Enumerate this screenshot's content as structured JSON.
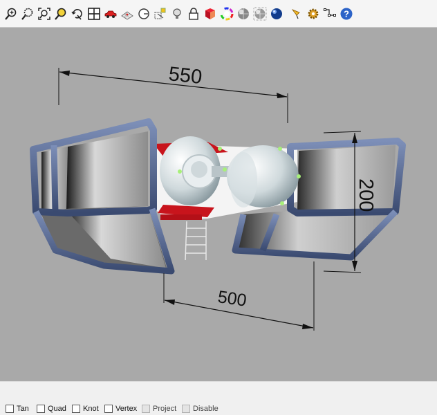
{
  "toolbar": {
    "icons": [
      "zoom-in-icon",
      "zoom-window-icon",
      "zoom-extents-icon",
      "zoom-selected-icon",
      "rotate-view-icon",
      "four-viewports-icon",
      "car-object-icon",
      "grid-plane-icon",
      "clock-icon",
      "select-points-icon",
      "light-bulb-icon",
      "lock-icon",
      "render-material-icon",
      "color-wheel-icon",
      "shaded-sphere-icon",
      "ghosted-sphere-icon",
      "rendered-sphere-icon",
      "pen-tool-icon",
      "gear-settings-icon",
      "polyline-points-icon",
      "help-icon"
    ]
  },
  "viewport": {
    "dimensions": {
      "top_width": "550",
      "right_height": "200",
      "bottom_width": "500"
    }
  },
  "statusbar": {
    "osnaps": [
      {
        "label": "Tan",
        "checked": false,
        "enabled": true
      },
      {
        "label": "Quad",
        "checked": false,
        "enabled": true
      },
      {
        "label": "Knot",
        "checked": false,
        "enabled": true
      },
      {
        "label": "Vertex",
        "checked": false,
        "enabled": true
      },
      {
        "label": "Project",
        "checked": false,
        "enabled": false
      },
      {
        "label": "Disable",
        "checked": false,
        "enabled": false
      }
    ]
  }
}
